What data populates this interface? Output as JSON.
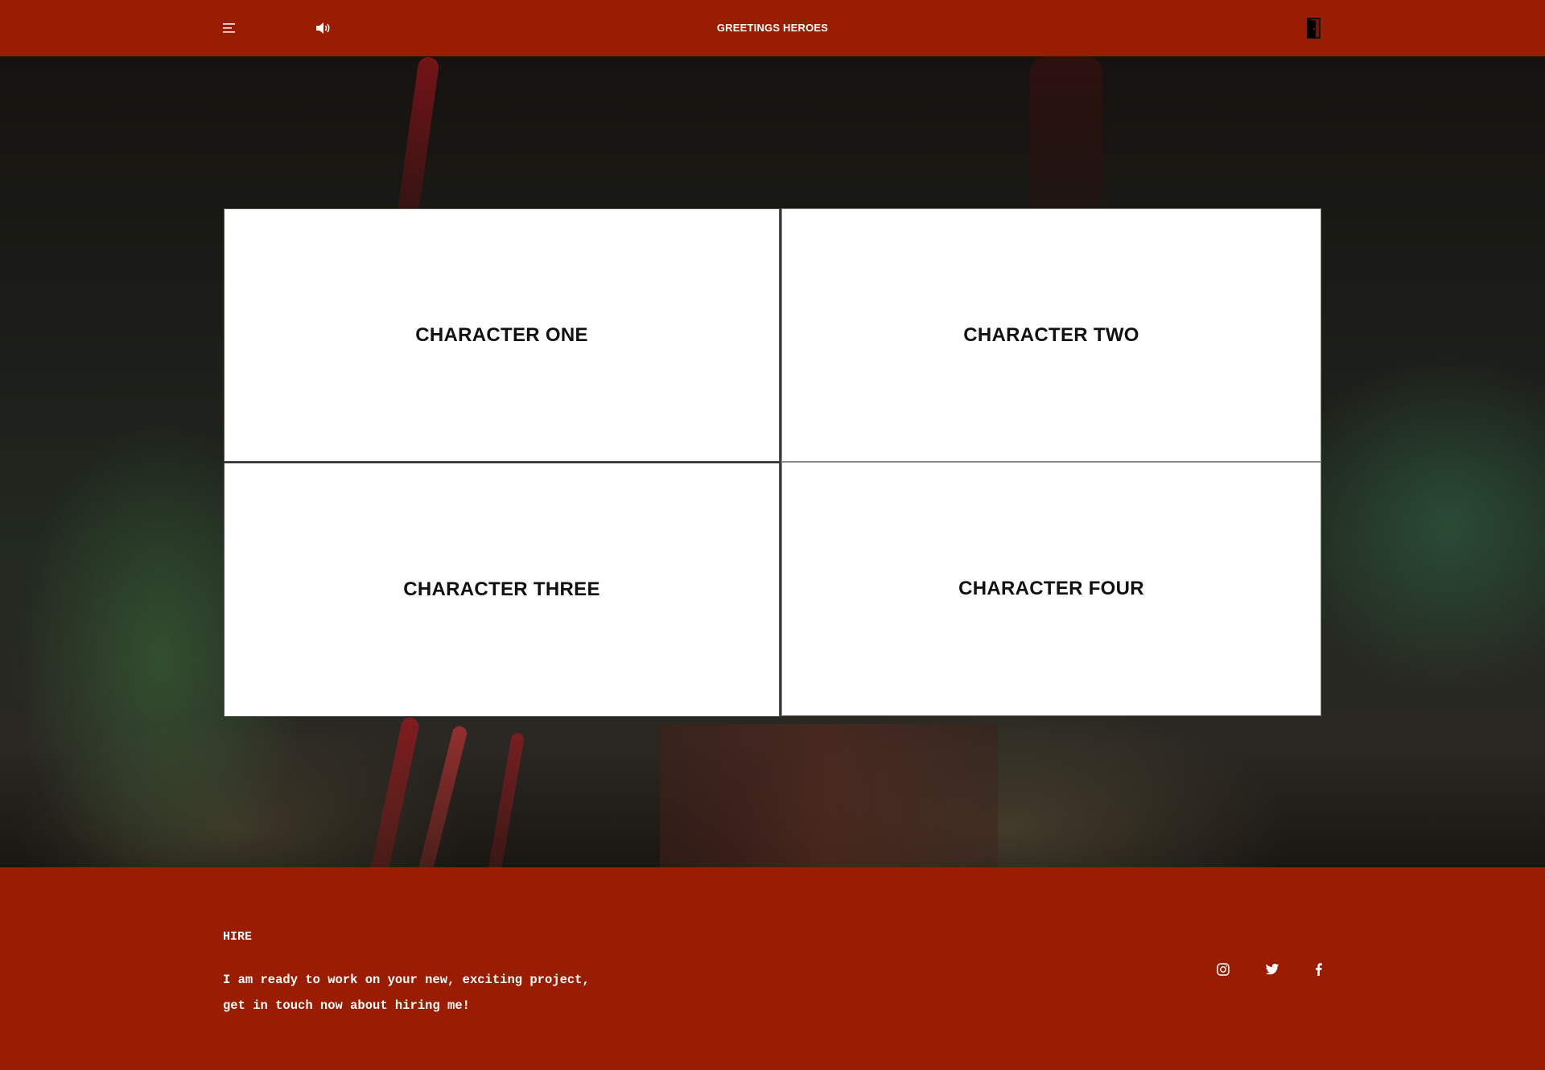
{
  "header": {
    "title": "GREETINGS HEROES",
    "icons": [
      "menu-icon",
      "speaker-icon",
      "door-exit-icon"
    ],
    "background_color": "#9a1c01"
  },
  "cards": [
    {
      "label": "CHARACTER ONE"
    },
    {
      "label": "CHARACTER TWO"
    },
    {
      "label": "CHARACTER THREE"
    },
    {
      "label": "CHARACTER FOUR"
    }
  ],
  "footer": {
    "heading": "HIRE",
    "message_line1": "I am ready to work on your new, exciting project,",
    "message_line2": "get in touch now about hiring me!",
    "social_icons": [
      "instagram-icon",
      "twitter-icon",
      "facebook-icon"
    ],
    "background_color": "#9a1c01"
  }
}
